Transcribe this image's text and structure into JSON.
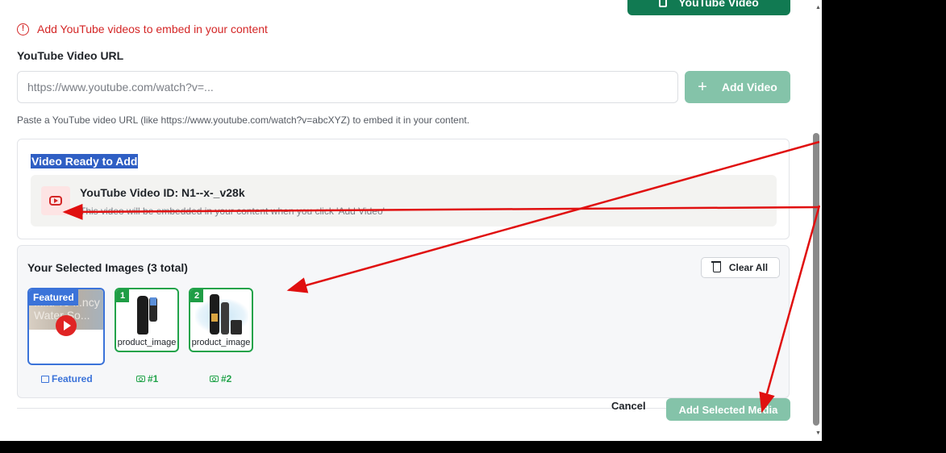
{
  "header": {
    "youtube_video_button": "YouTube Video"
  },
  "notice": {
    "icon": "alert-circle-icon",
    "text": "Add YouTube videos to embed in your content",
    "color": "#d42626"
  },
  "url_field": {
    "label": "YouTube Video URL",
    "placeholder": "https://www.youtube.com/watch?v=...",
    "value": "",
    "add_button": "Add Video",
    "hint": "Paste a YouTube video URL (like https://www.youtube.com/watch?v=abcXYZ) to embed it in your content."
  },
  "ready": {
    "title": "Video Ready to Add",
    "video_id": "YouTube Video ID: N1--x-_v28k",
    "note": "This video will be embedded in your content when you click 'Add Video'"
  },
  "selected": {
    "title": "Your Selected Images (3 total)",
    "clear_button": "Clear All",
    "items": [
      {
        "badge": "Featured",
        "thumb_text": "...iftPro ...ncy Water So...",
        "caption": "Featured"
      },
      {
        "badge": "1",
        "label": "product_image",
        "caption": "#1"
      },
      {
        "badge": "2",
        "label": "product_image",
        "caption": "#2"
      }
    ]
  },
  "footer": {
    "cancel": "Cancel",
    "add_selected": "Add Selected Media"
  },
  "colors": {
    "brand_green": "#117a52",
    "light_green": "#84c3a9",
    "blue": "#3b73d9",
    "annotation_red": "#e01010"
  }
}
